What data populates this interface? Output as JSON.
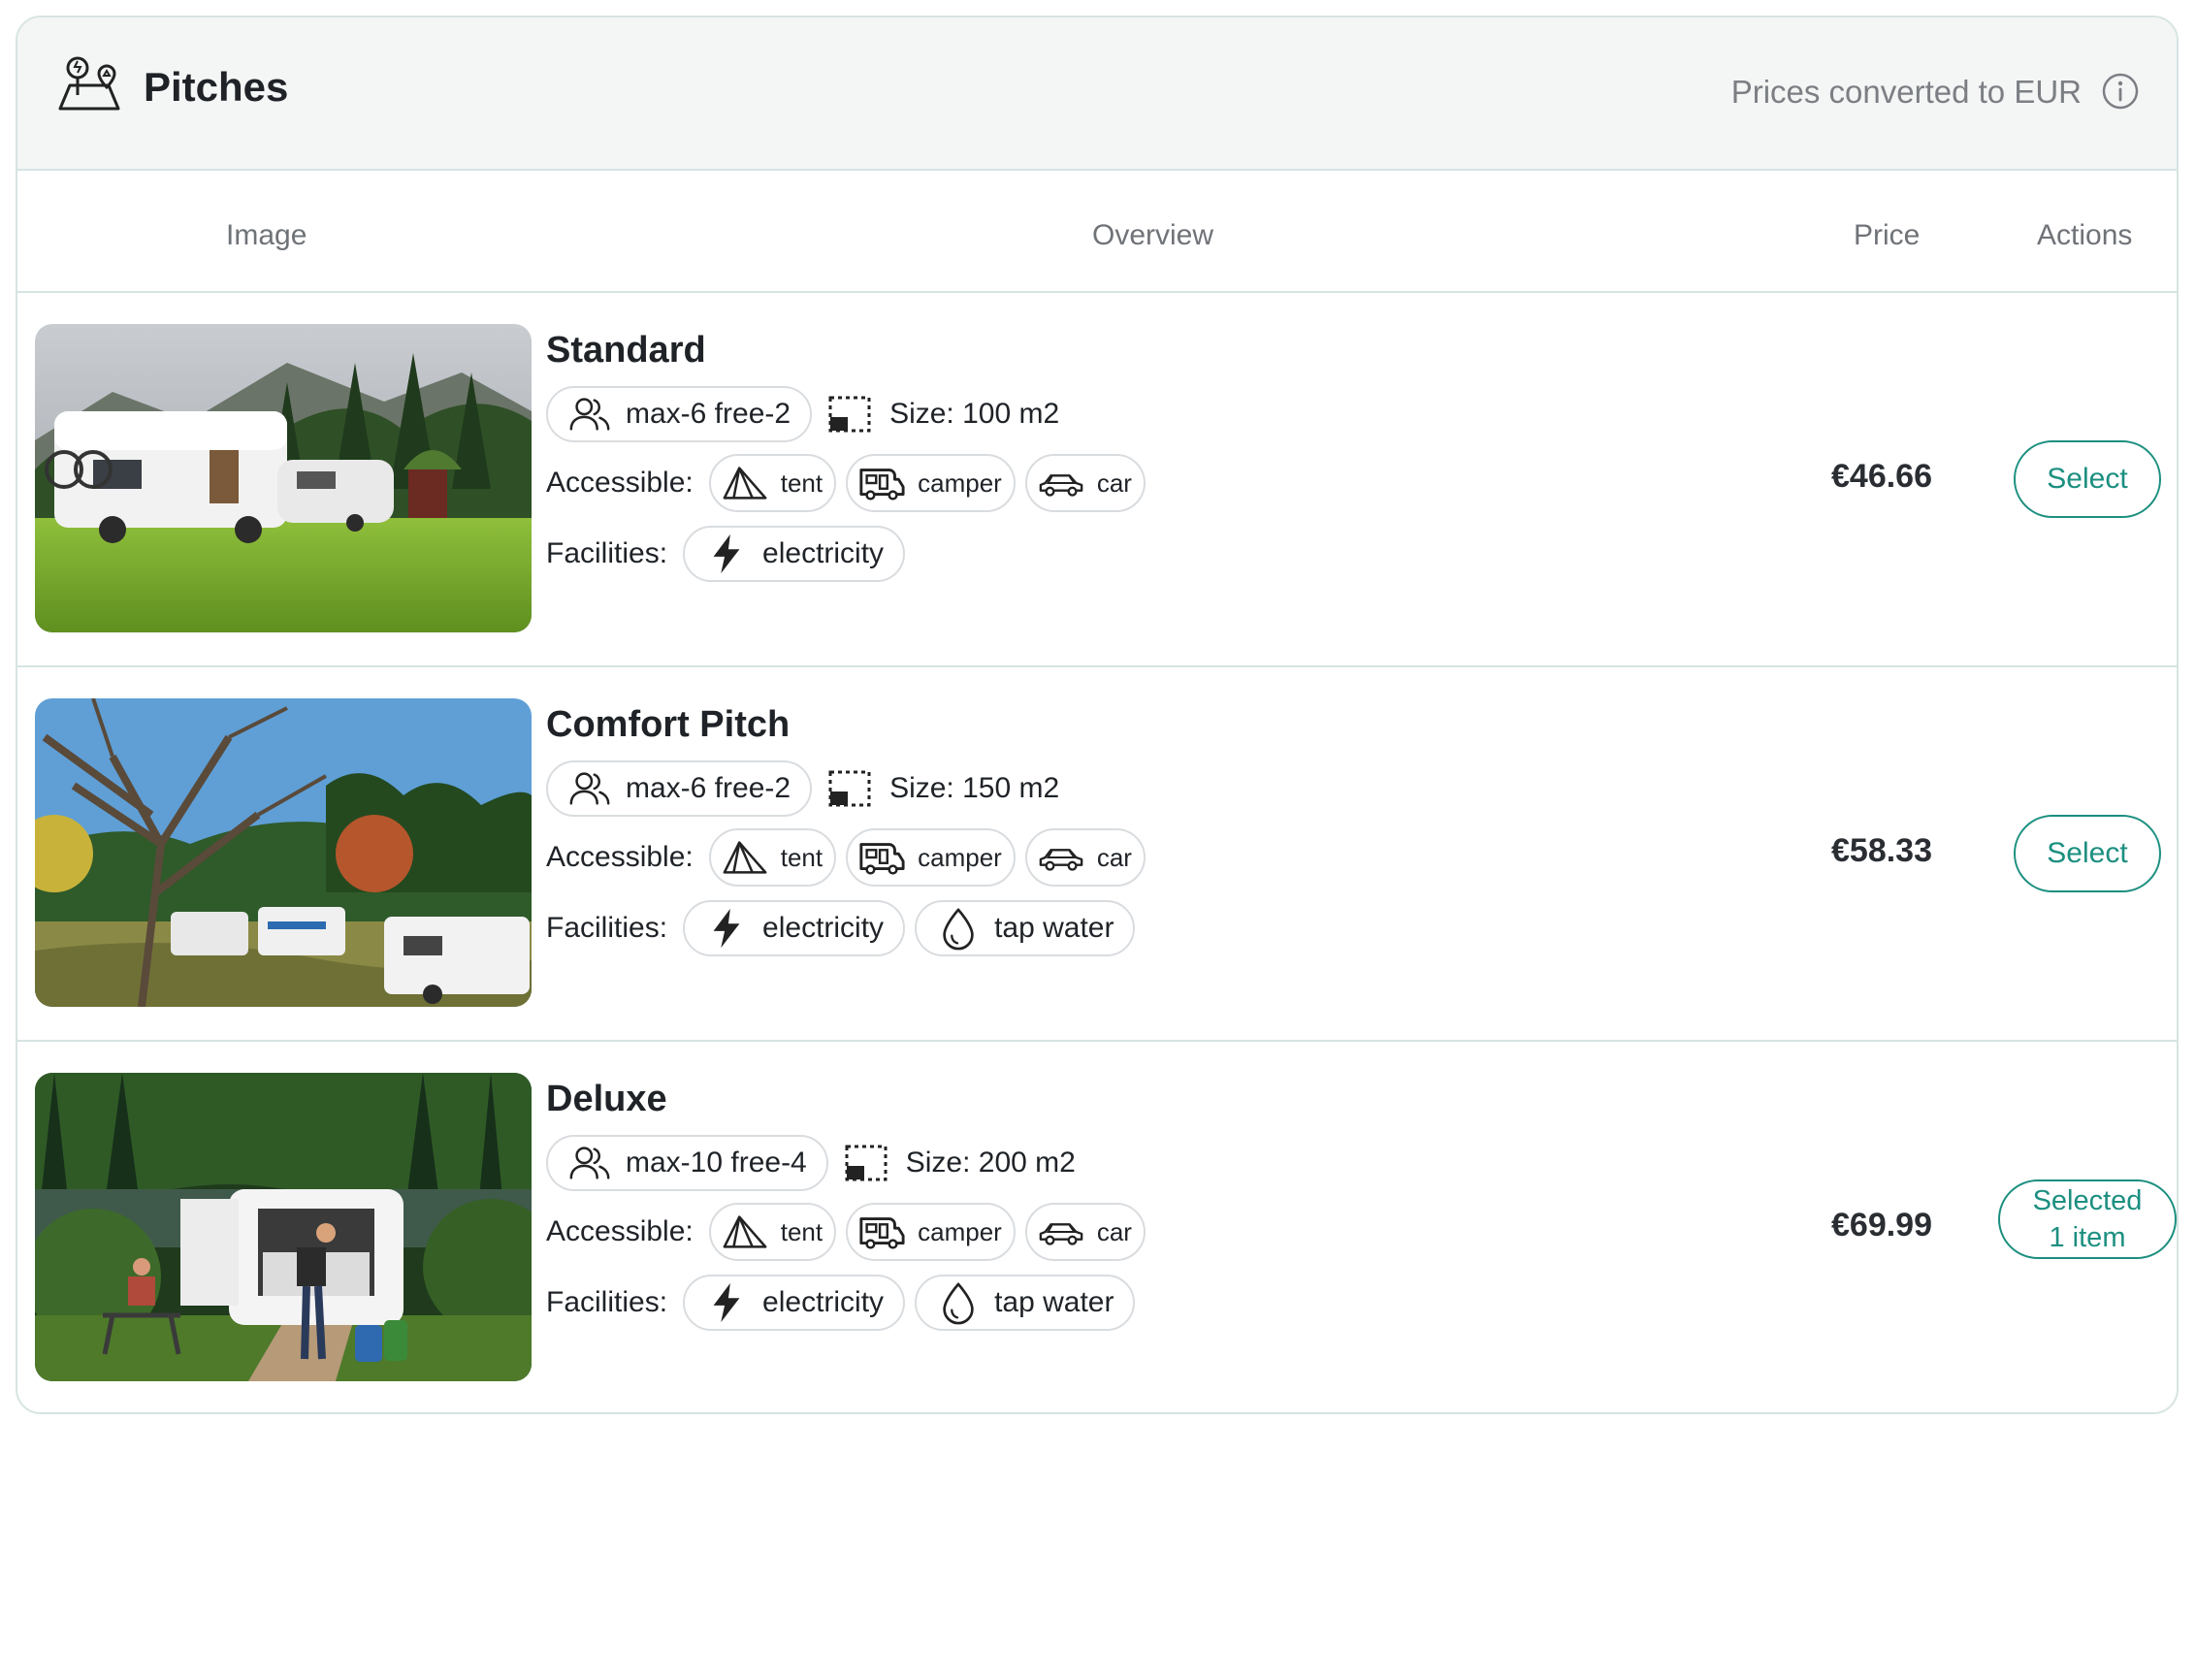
{
  "header": {
    "title": "Pitches",
    "prices_note": "Prices converted to EUR"
  },
  "table": {
    "columns": [
      "Image",
      "Overview",
      "Price",
      "Actions"
    ]
  },
  "labels": {
    "accessible": "Accessible:",
    "facilities": "Facilities:"
  },
  "pitches": [
    {
      "name": "Standard",
      "capacity": "max-6 free-2",
      "size": "Size: 100 m2",
      "accessible": [
        "tent",
        "camper",
        "car"
      ],
      "facilities": [
        "electricity"
      ],
      "price": "€46.66",
      "action": "Select"
    },
    {
      "name": "Comfort Pitch",
      "capacity": "max-6 free-2",
      "size": "Size: 150 m2",
      "accessible": [
        "tent",
        "camper",
        "car"
      ],
      "facilities": [
        "electricity",
        "tap water"
      ],
      "price": "€58.33",
      "action": "Select"
    },
    {
      "name": "Deluxe",
      "capacity": "max-10 free-4",
      "size": "Size: 200 m2",
      "accessible": [
        "tent",
        "camper",
        "car"
      ],
      "facilities": [
        "electricity",
        "tap water"
      ],
      "price": "€69.99",
      "action": "Selected",
      "action_sub": "1 item"
    }
  ],
  "icons": {
    "header": "map-pins-icon",
    "info": "info-circle-icon",
    "capacity": "users-icon",
    "size": "area-size-icon",
    "tent": "tent-icon",
    "camper": "camper-icon",
    "car": "car-icon",
    "electricity": "lightning-icon",
    "tap_water": "water-drop-icon"
  },
  "colors": {
    "accent": "#1c8f80",
    "border": "#d6e4e2",
    "header_bg": "#f4f5f5"
  }
}
